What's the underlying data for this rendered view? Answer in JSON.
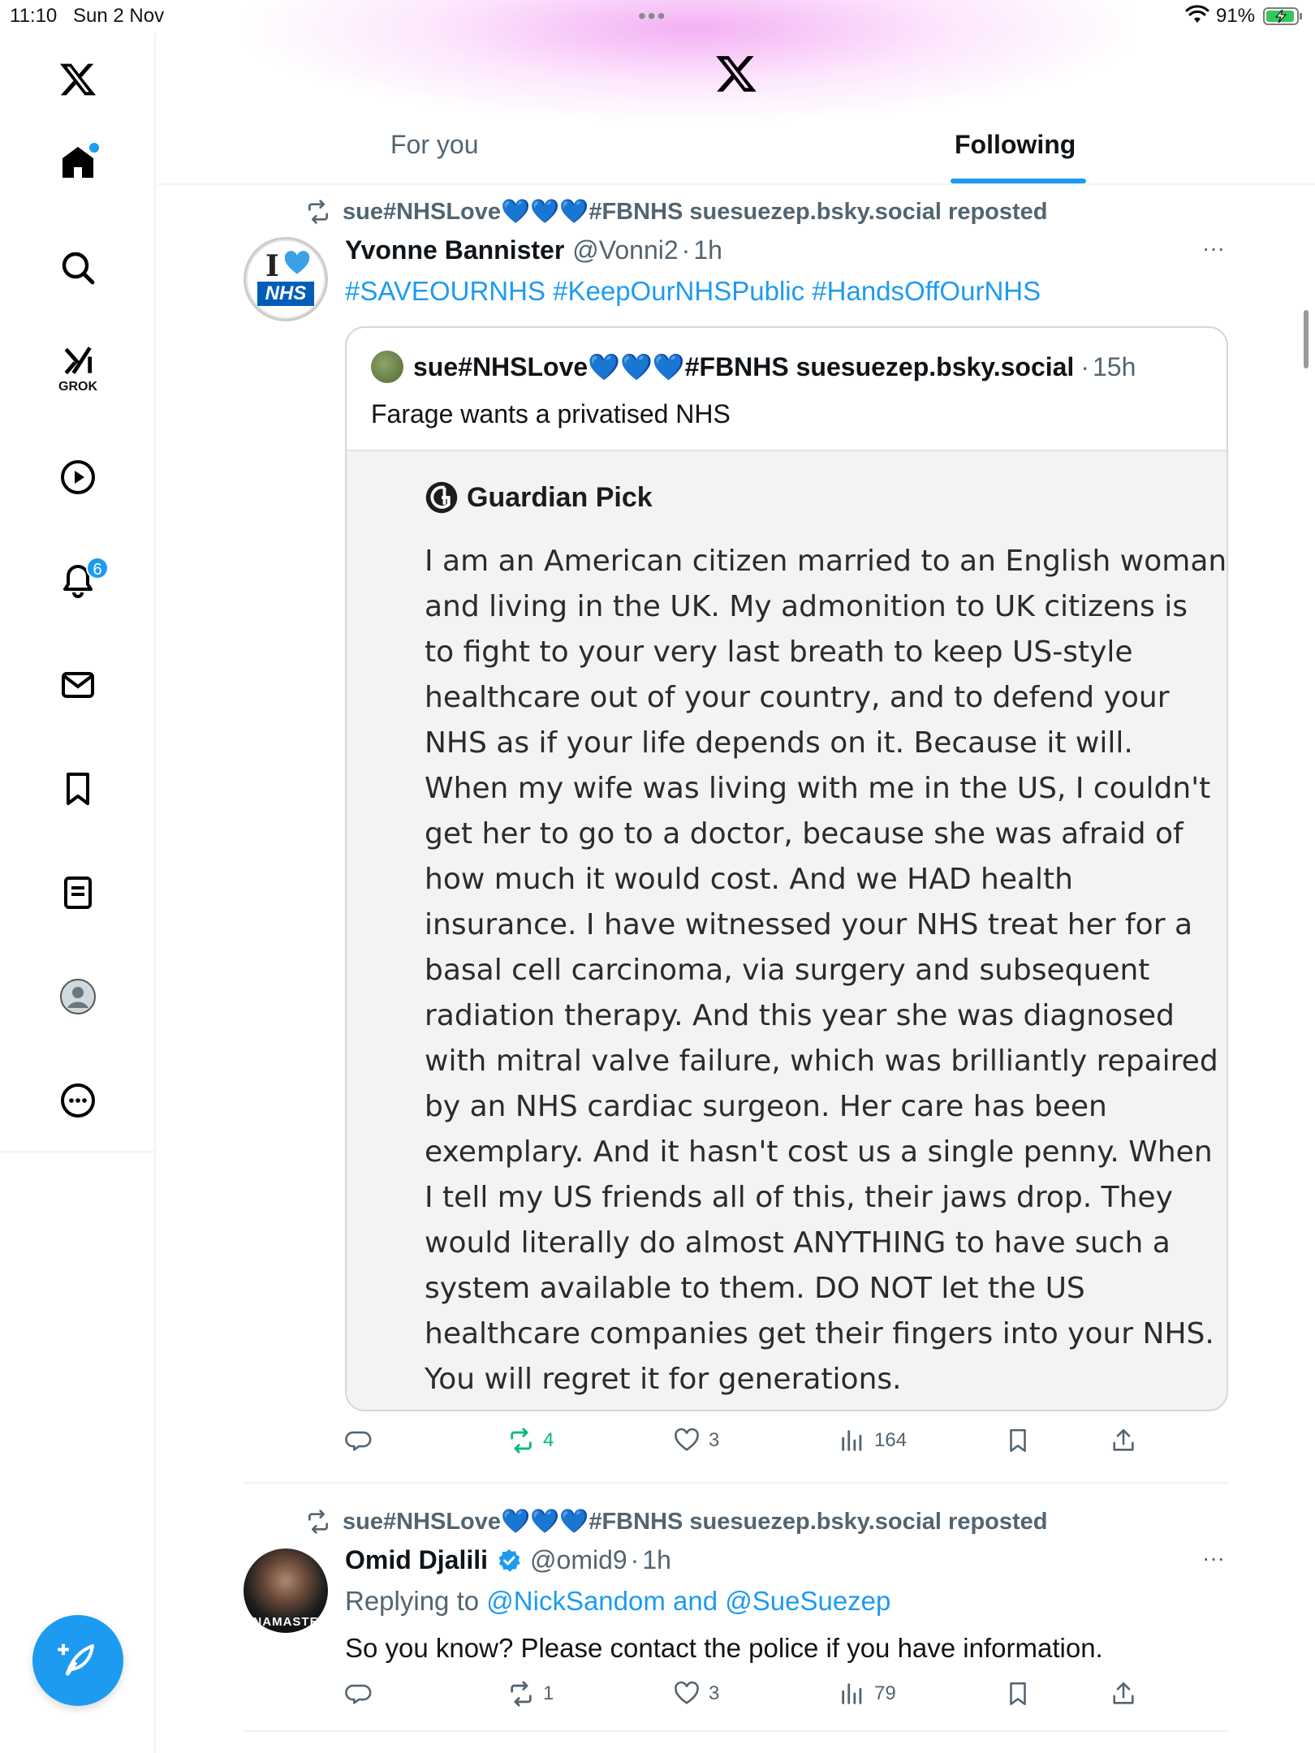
{
  "status_bar": {
    "time": "11:10",
    "date": "Sun 2 Nov",
    "battery": "91%"
  },
  "colors": {
    "accent": "#1d9bf0",
    "retweet_green": "#00ba7c",
    "muted": "#536471"
  },
  "sidebar": {
    "items": [
      {
        "name": "x-logo-icon"
      },
      {
        "name": "home-icon"
      },
      {
        "name": "search-icon"
      },
      {
        "name": "grok-icon",
        "label": "GROK"
      },
      {
        "name": "video-icon"
      },
      {
        "name": "notifications-icon",
        "badge": "6"
      },
      {
        "name": "messages-icon"
      },
      {
        "name": "bookmarks-icon"
      },
      {
        "name": "lists-icon"
      },
      {
        "name": "profile-icon"
      },
      {
        "name": "more-icon"
      }
    ]
  },
  "header": {
    "tabs": [
      {
        "label": "For you",
        "active": false
      },
      {
        "label": "Following",
        "active": true
      }
    ]
  },
  "posts": [
    {
      "repost_by": "sue#NHSLove💙💙💙#FBNHS suesuezep.bsky.social reposted",
      "author": "Yvonne Bannister",
      "handle": "@Vonni2",
      "separator": "·",
      "time": "1h",
      "avatar_text": "I",
      "avatar_badge": "NHS",
      "text": "#SAVEOURNHS #KeepOurNHSPublic #HandsOffOurNHS",
      "quote": {
        "author": "sue#NHSLove💙💙💙#FBNHS suesuezep.bsky.social",
        "separator": "·",
        "time": "15h",
        "text": "Farage wants a privatised NHS",
        "image": {
          "heading": "Guardian Pick",
          "lines": [
            "I am an American citizen married to an English woman",
            "and living in the UK. My admonition to UK citizens is",
            "to fight to your very last breath to keep US-style",
            "healthcare out of your country, and to defend your",
            "NHS as if your life depends on it. Because it will.",
            "When my wife was living with me in the US, I couldn't",
            "get her to go to a doctor, because she was afraid of",
            "how much it would cost. And we HAD health",
            "insurance. I have witnessed your NHS treat her for a",
            "basal cell carcinoma, via surgery and subsequent",
            "radiation therapy. And this year she was diagnosed",
            "with mitral valve failure, which was brilliantly repaired",
            "by an NHS cardiac surgeon. Her care has been",
            "exemplary. And it hasn't cost us a single penny. When",
            "I tell my US friends all of this, their jaws drop. They",
            "would literally do almost ANYTHING to have such a",
            "system available to them. DO NOT let the US",
            "healthcare companies get their fingers into your NHS.",
            "You will regret it for generations."
          ]
        }
      },
      "stats": {
        "replies": "",
        "reposts": "4",
        "likes": "3",
        "views": "164"
      }
    },
    {
      "repost_by": "sue#NHSLove💙💙💙#FBNHS suesuezep.bsky.social reposted",
      "author": "Omid Djalili",
      "handle": "@omid9",
      "separator": "·",
      "time": "1h",
      "avatar_text": "NAMASTE",
      "replying_prefix": "Replying to",
      "replying_to": "@NickSandom and @SueSuezep",
      "text": "So you know? Please contact the police if you have information.",
      "stats": {
        "replies": "",
        "reposts": "1",
        "likes": "3",
        "views": "79"
      }
    }
  ]
}
